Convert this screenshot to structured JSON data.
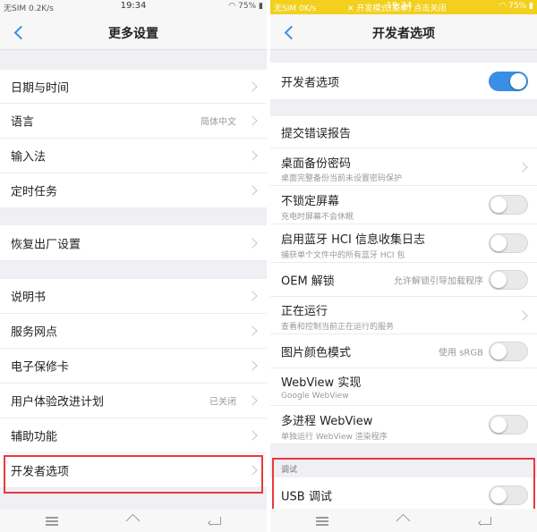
{
  "colors": {
    "accent": "#3a8ee6",
    "dev_bar": "#f3d01e",
    "highlight": "#e8393e"
  },
  "left": {
    "status": {
      "carrier": "无SIM 0.2K/s",
      "time": "19:34",
      "battery": "75%"
    },
    "header": {
      "title": "更多设置",
      "back_icon": "chevron-left-icon"
    },
    "items": [
      {
        "label": "日期与时间",
        "value": ""
      },
      {
        "label": "语言",
        "value": "简体中文"
      },
      {
        "label": "输入法",
        "value": ""
      },
      {
        "label": "定时任务",
        "value": ""
      },
      {
        "label": "恢复出厂设置",
        "value": ""
      },
      {
        "label": "说明书",
        "value": ""
      },
      {
        "label": "服务网点",
        "value": ""
      },
      {
        "label": "电子保修卡",
        "value": ""
      },
      {
        "label": "用户体验改进计划",
        "value": "已关闭"
      },
      {
        "label": "辅助功能",
        "value": ""
      },
      {
        "label": "开发者选项",
        "value": ""
      }
    ]
  },
  "right": {
    "status": {
      "carrier": "无SIM 0K/s",
      "dev_mode": "开发模式(菜单)",
      "dev_close": "点击关闭",
      "time": "19:34",
      "battery": "75%"
    },
    "header": {
      "title": "开发者选项",
      "back_icon": "chevron-left-icon"
    },
    "master_toggle": {
      "label": "开发者选项",
      "on": true
    },
    "items": [
      {
        "title": "提交错误报告"
      },
      {
        "title": "桌面备份密码",
        "subtitle": "桌面完整备份当前未设置密码保护"
      },
      {
        "title": "不锁定屏幕",
        "subtitle": "充电时屏幕不会休眠",
        "toggle": false
      },
      {
        "title": "启用蓝牙 HCI 信息收集日志",
        "subtitle": "捕获单个文件中的所有蓝牙 HCI 包",
        "toggle": false
      },
      {
        "title": "OEM 解锁",
        "value": "允许解锁引导加载程序",
        "toggle": false
      },
      {
        "title": "正在运行",
        "subtitle": "查看和控制当前正在运行的服务"
      },
      {
        "title": "图片颜色模式",
        "value": "使用 sRGB",
        "toggle": false
      },
      {
        "title": "WebView 实现",
        "subtitle": "Google WebView"
      },
      {
        "title": "多进程 WebView",
        "subtitle": "单独运行 WebView 渲染程序",
        "toggle": false
      }
    ],
    "debug_section": {
      "label": "调试"
    },
    "usb_debug": {
      "title": "USB 调试",
      "toggle": false
    }
  },
  "nav_icons": [
    "menu-icon",
    "home-icon",
    "back-icon"
  ]
}
